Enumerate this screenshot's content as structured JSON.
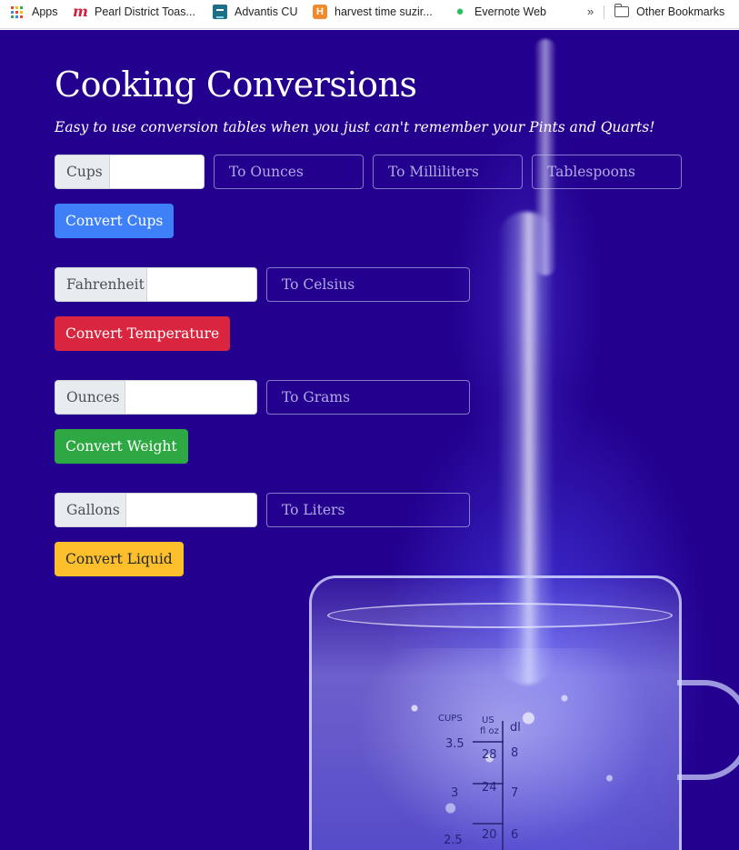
{
  "bookmarks_bar": {
    "items": [
      {
        "label": "Apps",
        "icon": "apps-grid-icon"
      },
      {
        "label": "Pearl District Toas...",
        "icon": "meetup-icon"
      },
      {
        "label": "Advantis CU",
        "icon": "advantis-icon"
      },
      {
        "label": "harvest time suzir...",
        "icon": "harvest-h-icon"
      },
      {
        "label": "Evernote Web",
        "icon": "evernote-icon"
      }
    ],
    "overflow_label": "»",
    "other_bookmarks_label": "Other Bookmarks"
  },
  "page": {
    "title": "Cooking Conversions",
    "subtitle": "Easy to use conversion tables when you just can't remember your Pints and Quarts!"
  },
  "converters": {
    "cups": {
      "input_label": "Cups",
      "input_value": "",
      "outputs": [
        "To Ounces",
        "To Milliliters",
        "Tablespoons"
      ],
      "button_label": "Convert Cups",
      "button_color": "#3e80f7"
    },
    "temperature": {
      "input_label": "Fahrenheit",
      "input_value": "",
      "outputs": [
        "To Celsius"
      ],
      "button_label": "Convert Temperature",
      "button_color": "#d9263e"
    },
    "weight": {
      "input_label": "Ounces",
      "input_value": "",
      "outputs": [
        "To Grams"
      ],
      "button_label": "Convert Weight",
      "button_color": "#2ea843"
    },
    "liquid": {
      "input_label": "Gallons",
      "input_value": "",
      "outputs": [
        "To Liters"
      ],
      "button_label": "Convert Liquid",
      "button_color": "#fdc02c"
    }
  },
  "background": {
    "color": "#23008e",
    "beaker_markings": [
      "CUPS",
      "US",
      "fl oz",
      "dl",
      "3.5",
      "28",
      "8",
      "24",
      "7",
      "3",
      "20",
      "6",
      "2.5"
    ]
  },
  "theme": {
    "addon_bg": "#e9ecef",
    "text_white": "#ffffff"
  }
}
